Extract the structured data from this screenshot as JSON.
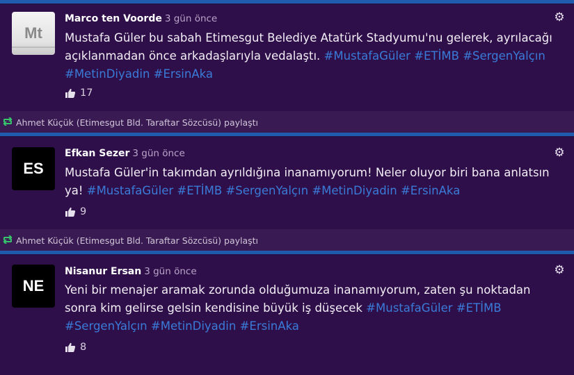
{
  "posts": [
    {
      "author": "Marco ten Voorde",
      "time": "3 gün önce",
      "avatar": "Mt",
      "text": "Mustafa Güler bu sabah Etimesgut Belediye Atatürk Stadyumu'nu gelerek, ayrılacağı açıklanmadan önce arkadaşlarıyla vedalaştı.",
      "tags": [
        "#MustafaGüler",
        "#ETİMB",
        "#SergenYalçın",
        "#MetinDiyadin",
        "#ErsinAka"
      ],
      "likes": "17"
    },
    {
      "author": "Efkan Sezer",
      "time": "3 gün önce",
      "avatar": "ES",
      "text": "Mustafa Güler'in takımdan ayrıldığına inanamıyorum! Neler oluyor biri bana anlatsın ya!",
      "tags": [
        "#MustafaGüler",
        "#ETİMB",
        "#SergenYalçın",
        "#MetinDiyadin",
        "#ErsinAka"
      ],
      "likes": "9"
    },
    {
      "author": "Nisanur Ersan",
      "time": "3 gün önce",
      "avatar": "NE",
      "text": "Yeni bir menajer aramak zorunda olduğumuza inanamıyorum, zaten şu noktadan sonra kim gelirse gelsin kendisine büyük iş düşecek",
      "tags": [
        "#MustafaGüler",
        "#ETİMB",
        "#SergenYalçın",
        "#MetinDiyadin",
        "#ErsinAka"
      ],
      "likes": "8"
    }
  ],
  "shares": [
    {
      "text": "Ahmet Küçük (Etimesgut Bld. Taraftar Sözcüsü) paylaştı",
      "icon": "retweet-icon"
    },
    {
      "text": "Ahmet Küçük (Etimesgut Bld. Taraftar Sözcüsü) paylaştı",
      "icon": "retweet-icon"
    }
  ],
  "icons": {
    "settings": "gear-icon",
    "like": "thumbs-up-icon"
  },
  "colors": {
    "background": "#3a1a52",
    "card": "#2f0f4a",
    "accent_bar": "#1f5cae",
    "hashtag": "#3a7bd8",
    "share_icon": "#36c36b"
  }
}
